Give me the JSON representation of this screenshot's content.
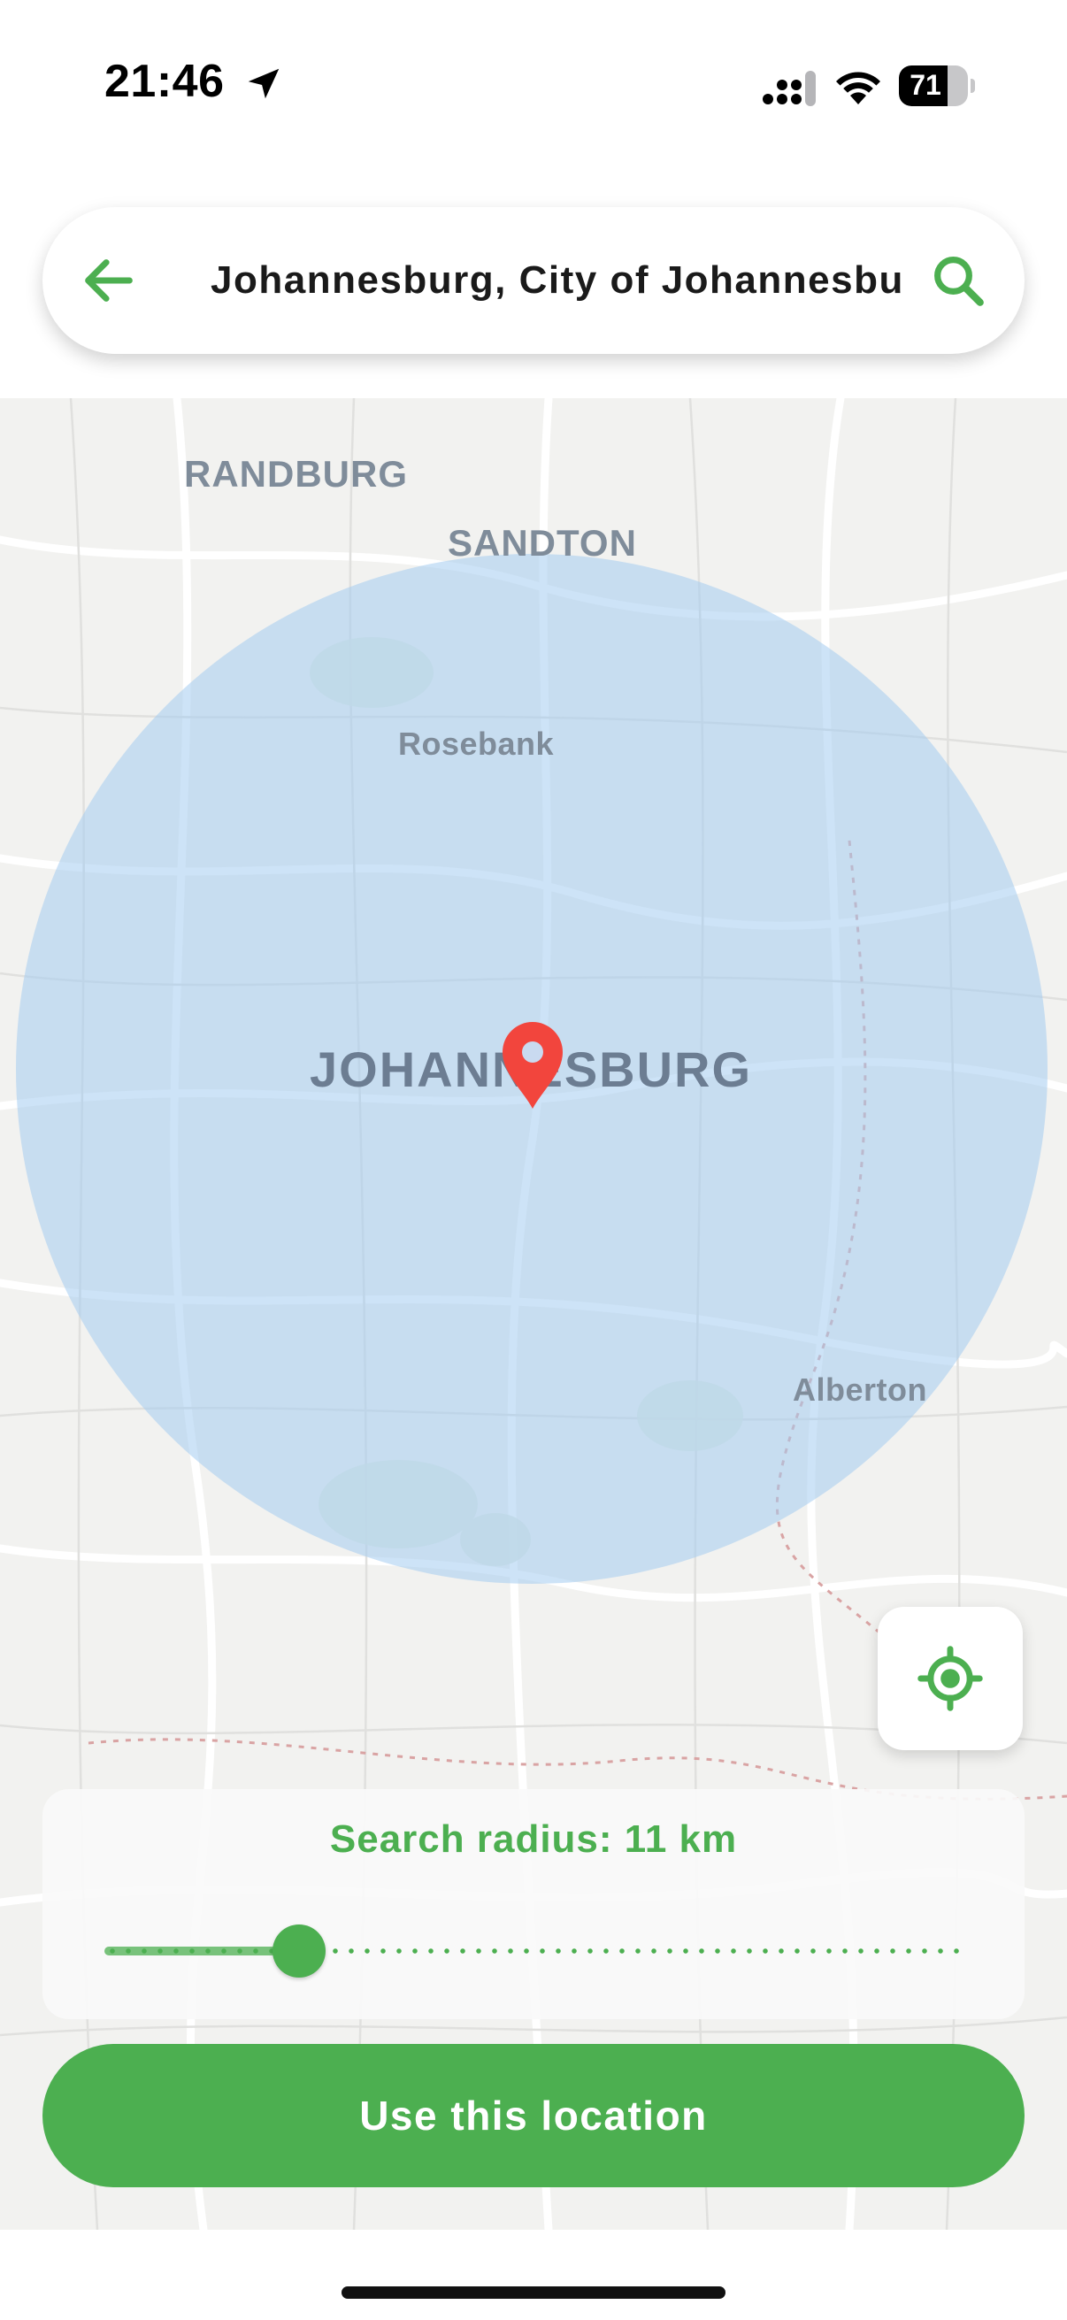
{
  "status_bar": {
    "time": "21:46",
    "battery_level": "71",
    "battery_fraction": 0.71,
    "icons": [
      "location-arrow-icon",
      "cellular-signal-icon",
      "wifi-icon",
      "battery-icon"
    ]
  },
  "search": {
    "query": "Johannesburg, City of Johannesburg",
    "back_icon": "arrow-left-icon",
    "search_icon": "search-icon"
  },
  "map": {
    "labels": {
      "randburg": "RANDBURG",
      "sandton": "SANDTON",
      "rosebank": "Rosebank",
      "johannesburg": "JOHANNESBURG",
      "alberton": "Alberton"
    },
    "pin_icon": "map-pin-icon",
    "locate_icon": "my-location-icon",
    "radius_fill": "#a4ccf0",
    "pin_color": "#f2453d"
  },
  "radius": {
    "label": "Search radius: 11 km",
    "value_km": 11,
    "slider_fraction": 0.21
  },
  "actions": {
    "use_location": "Use this location"
  },
  "colors": {
    "accent": "#4caf50",
    "pin": "#f2453d"
  }
}
